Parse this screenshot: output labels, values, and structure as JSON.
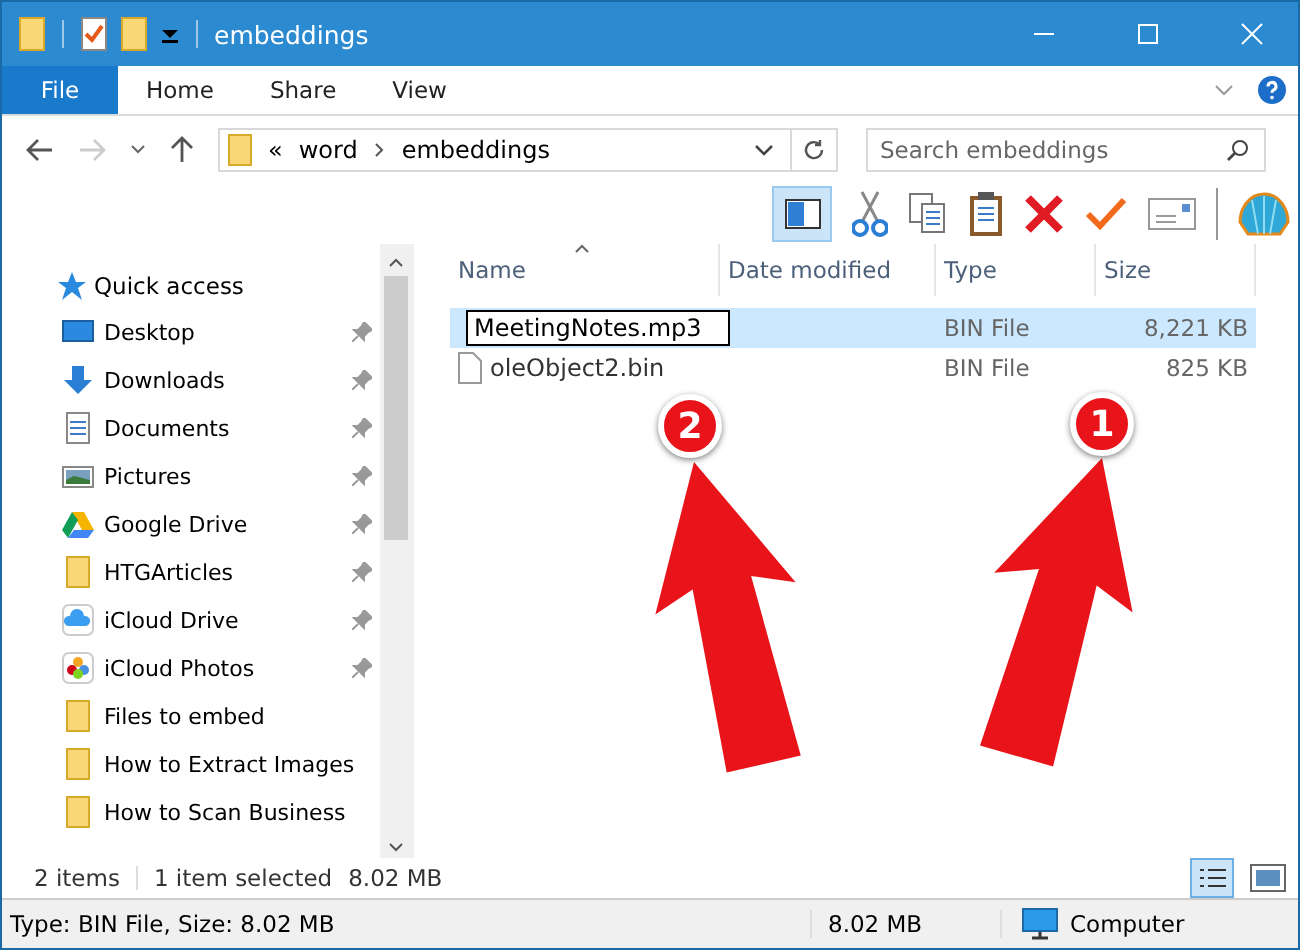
{
  "window": {
    "title": "embeddings"
  },
  "ribbon_tabs": [
    {
      "label": "File",
      "selected": true
    },
    {
      "label": "Home",
      "selected": false
    },
    {
      "label": "Share",
      "selected": false
    },
    {
      "label": "View",
      "selected": false
    }
  ],
  "address": {
    "overflow": "«",
    "path": [
      "word",
      "embeddings"
    ]
  },
  "search": {
    "placeholder": "Search embeddings"
  },
  "sidebar": {
    "header": "Quick access",
    "items": [
      {
        "label": "Desktop",
        "kind": "desktop",
        "pinned": true
      },
      {
        "label": "Downloads",
        "kind": "downloads",
        "pinned": true
      },
      {
        "label": "Documents",
        "kind": "documents",
        "pinned": true
      },
      {
        "label": "Pictures",
        "kind": "pictures",
        "pinned": true
      },
      {
        "label": "Google Drive",
        "kind": "gdrive",
        "pinned": true
      },
      {
        "label": "HTGArticles",
        "kind": "folder",
        "pinned": true
      },
      {
        "label": "iCloud Drive",
        "kind": "icloud",
        "pinned": true
      },
      {
        "label": "iCloud Photos",
        "kind": "photos",
        "pinned": true
      },
      {
        "label": "Files to embed",
        "kind": "folder",
        "pinned": false
      },
      {
        "label": "How to Extract Images",
        "kind": "folder",
        "pinned": false
      },
      {
        "label": "How to Scan Business",
        "kind": "folder",
        "pinned": false
      }
    ]
  },
  "columns": [
    "Name",
    "Date modified",
    "Type",
    "Size"
  ],
  "files": [
    {
      "name": "MeetingNotes.mp3",
      "type": "BIN File",
      "size": "8,221 KB",
      "selected": true,
      "renaming": true
    },
    {
      "name": "oleObject2.bin",
      "type": "BIN File",
      "size": "825 KB",
      "selected": false,
      "renaming": false
    }
  ],
  "status": {
    "count": "2 items",
    "selection": "1 item selected",
    "selection_size": "8.02 MB"
  },
  "status_bar": {
    "info": "Type: BIN File, Size: 8.02 MB",
    "size": "8.02 MB",
    "location": "Computer"
  },
  "callouts": [
    {
      "number": "2"
    },
    {
      "number": "1"
    }
  ]
}
